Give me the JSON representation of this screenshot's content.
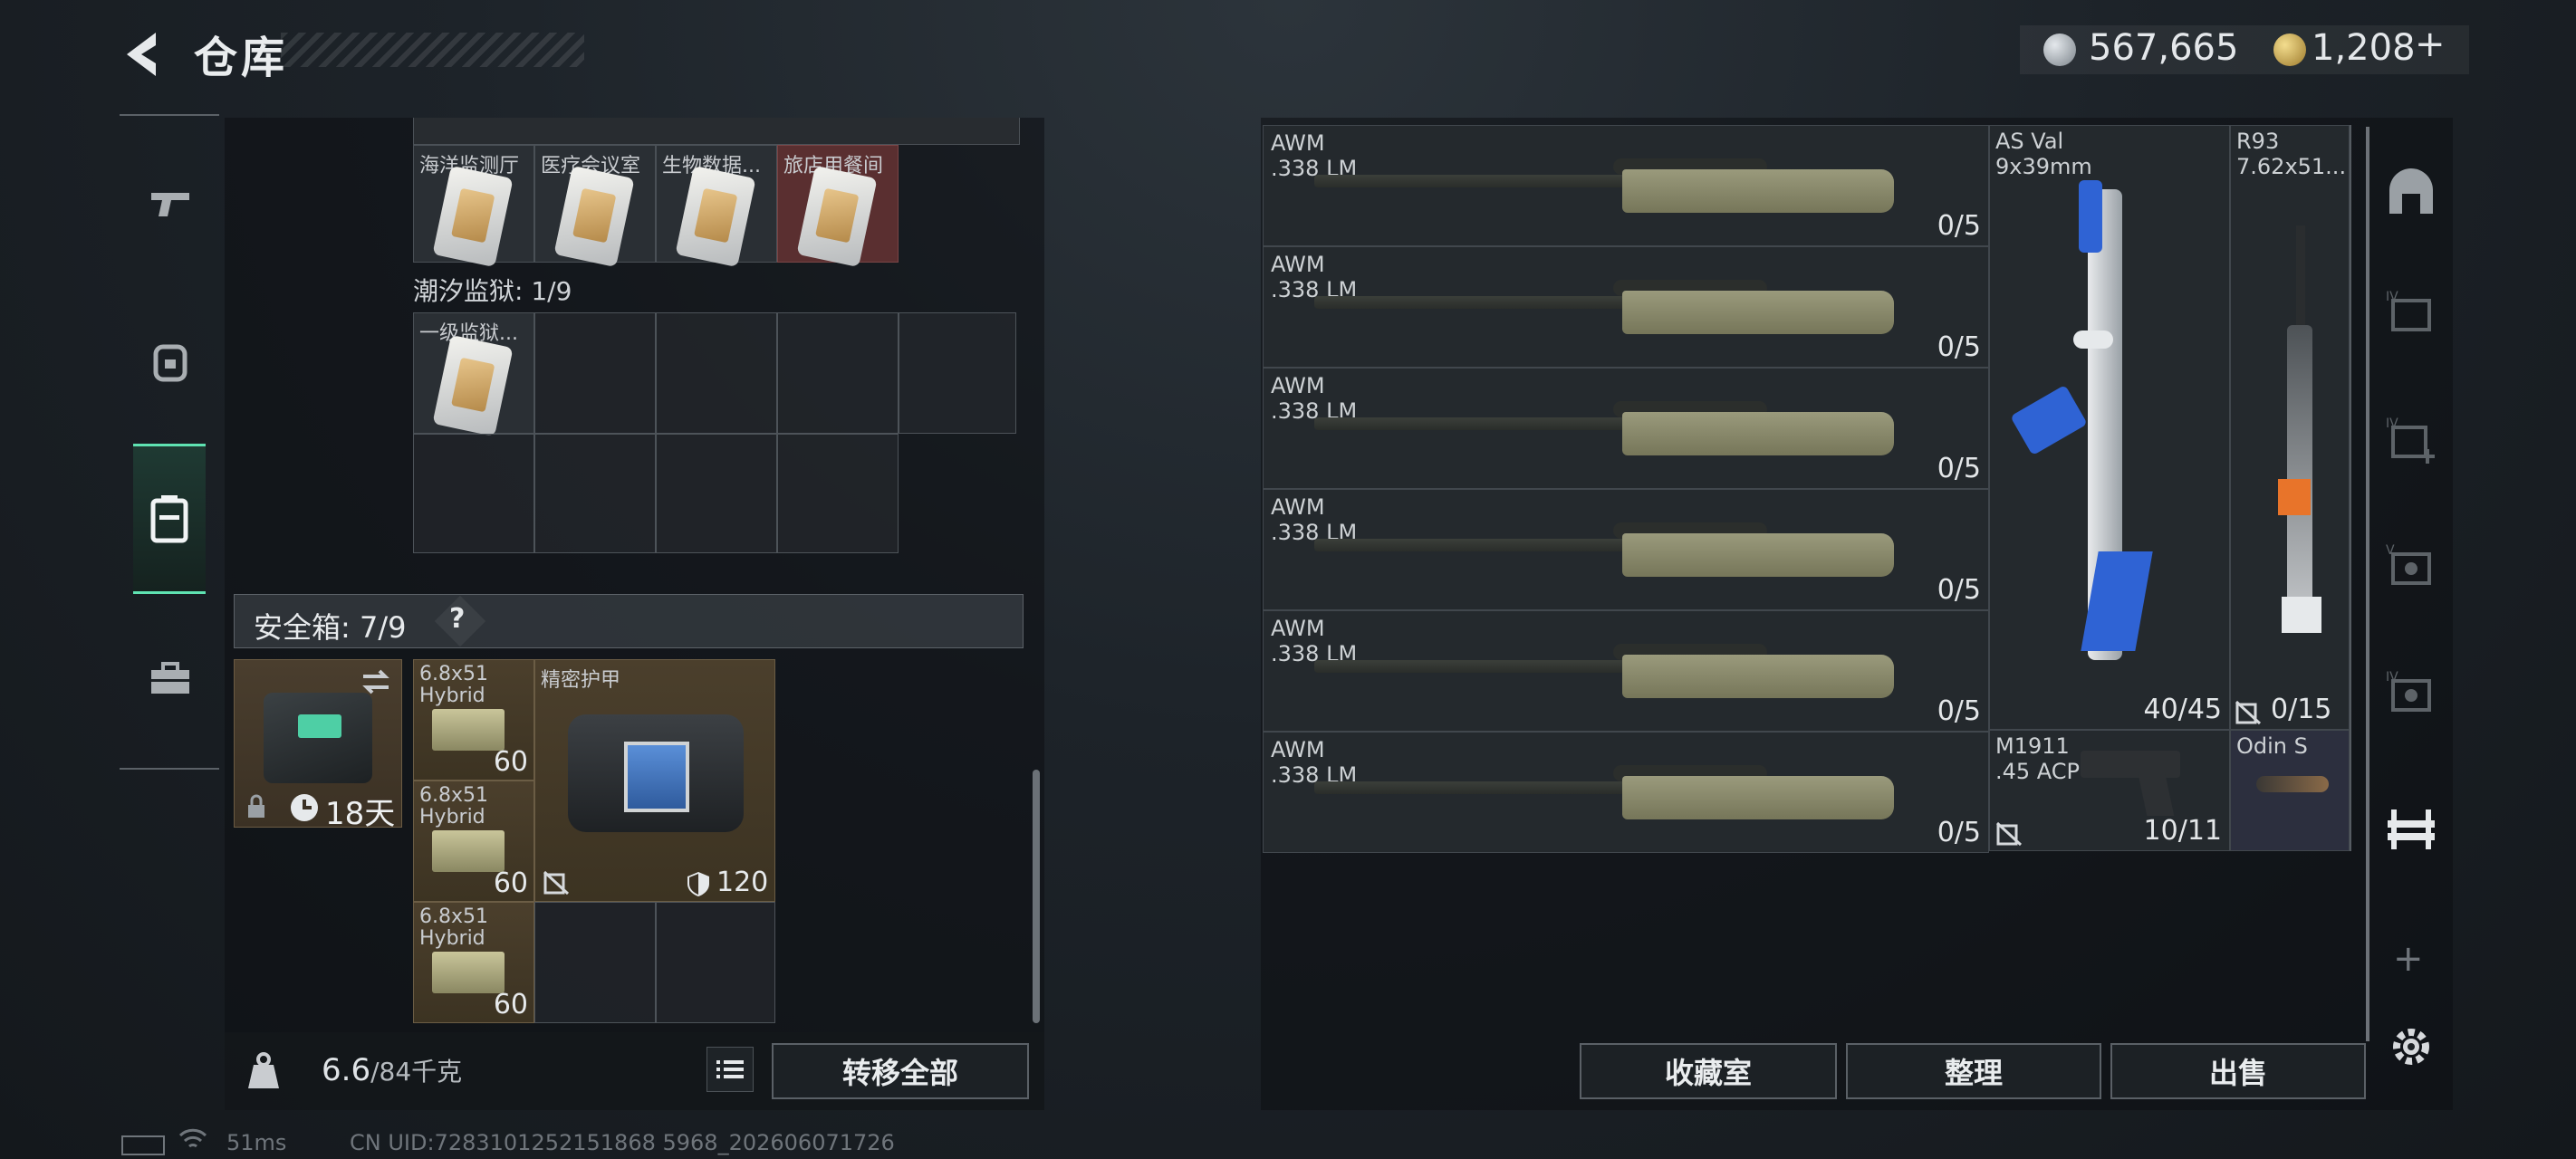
{
  "header": {
    "title": "仓库",
    "back_icon": "back-arrow-icon"
  },
  "currency": [
    {
      "icon": "silver-coin-icon",
      "value": "567,665",
      "color": "#b0b6bb"
    },
    {
      "icon": "gold-coin-icon",
      "value": "1,208",
      "color": "#c9a94a",
      "add": "+"
    }
  ],
  "nav": [
    {
      "name": "weapons",
      "icon": "pistol-icon"
    },
    {
      "name": "armor",
      "icon": "helmet-icon"
    },
    {
      "name": "backpack",
      "icon": "backpack-icon",
      "active": true
    },
    {
      "name": "tools",
      "icon": "toolbox-icon"
    }
  ],
  "keycards_top": [
    {
      "label": "海洋监测厅",
      "tint": "normal"
    },
    {
      "label": "医疗会议室",
      "tint": "normal"
    },
    {
      "label": "生物数据...",
      "tint": "normal"
    },
    {
      "label": "旅店用餐间",
      "tint": "red"
    }
  ],
  "prison": {
    "label": "潮汐监狱: 1/9",
    "items": [
      {
        "label": "一级监狱..."
      }
    ]
  },
  "safebox": {
    "title": "安全箱: 7/9",
    "help": "?",
    "timer": "18天",
    "items": [
      {
        "label": "6.8x51 Hybrid",
        "count": "60"
      },
      {
        "label": "6.8x51 Hybrid",
        "count": "60"
      },
      {
        "label": "6.8x51 Hybrid",
        "count": "60"
      }
    ],
    "armor": {
      "label": "精密护甲",
      "durability": "120"
    }
  },
  "weight": {
    "value": "6.6",
    "max": "/84千克"
  },
  "buttons": {
    "transfer_all": "转移全部",
    "collection": "收藏室",
    "organize": "整理",
    "sell": "出售"
  },
  "weapons": [
    {
      "name": "AWM",
      "caliber": ".338 LM",
      "ammo": "0/5"
    },
    {
      "name": "AWM",
      "caliber": ".338 LM",
      "ammo": "0/5"
    },
    {
      "name": "AWM",
      "caliber": ".338 LM",
      "ammo": "0/5"
    },
    {
      "name": "AWM",
      "caliber": ".338 LM",
      "ammo": "0/5"
    },
    {
      "name": "AWM",
      "caliber": ".338 LM",
      "ammo": "0/5"
    },
    {
      "name": "AWM",
      "caliber": ".338 LM",
      "ammo": "0/5"
    }
  ],
  "as_val": {
    "name": "AS Val",
    "caliber": "9x39mm",
    "ammo": "40/45"
  },
  "r93": {
    "name": "R93",
    "caliber": "7.62x51...",
    "ammo": "0/15"
  },
  "m1911": {
    "name": "M1911",
    "caliber": ".45 ACP",
    "ammo": "10/11"
  },
  "odin": {
    "name": "Odin S"
  },
  "side_tabs": [
    "shelter-icon",
    "shelf-iv-icon",
    "shelf-iv-plus-icon",
    "shelf-v-icon",
    "shelf-iv-b-icon",
    "gun-rack-icon"
  ],
  "side_add": "+",
  "status": {
    "ping": "51ms",
    "uid": "CN UID:7283101252151868 5968_202606071726"
  }
}
